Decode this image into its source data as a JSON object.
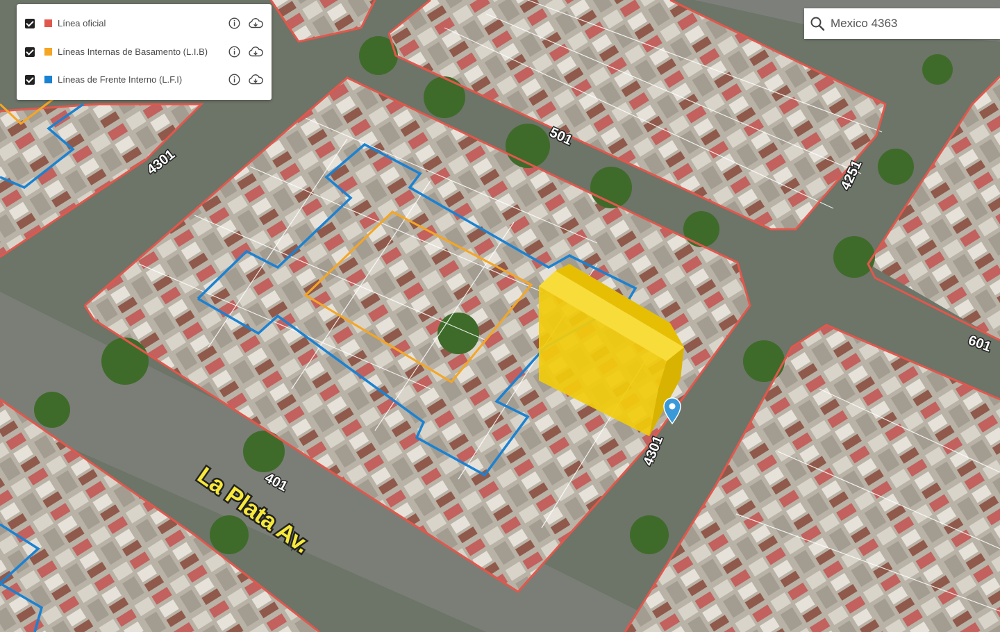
{
  "legend": {
    "layers": [
      {
        "label": "Línea oficial",
        "checked": true,
        "color": "#e2574c"
      },
      {
        "label": "Líneas Internas de Basamento (L.I.B)",
        "checked": true,
        "color": "#f5a623"
      },
      {
        "label": "Líneas de Frente Interno (L.F.I)",
        "checked": true,
        "color": "#1a82d3"
      }
    ]
  },
  "search": {
    "value": "Mexico 4363"
  },
  "map": {
    "street_numbers": [
      "4301",
      "501",
      "4251",
      "601",
      "4301",
      "401"
    ],
    "street_name": "La Plata Av.",
    "colors": {
      "official_line": "#e2574c",
      "basement_line": "#f5a623",
      "interior_front_line": "#1a82d3",
      "building": "#f2cc0c",
      "marker": "#3a9ad9"
    }
  }
}
